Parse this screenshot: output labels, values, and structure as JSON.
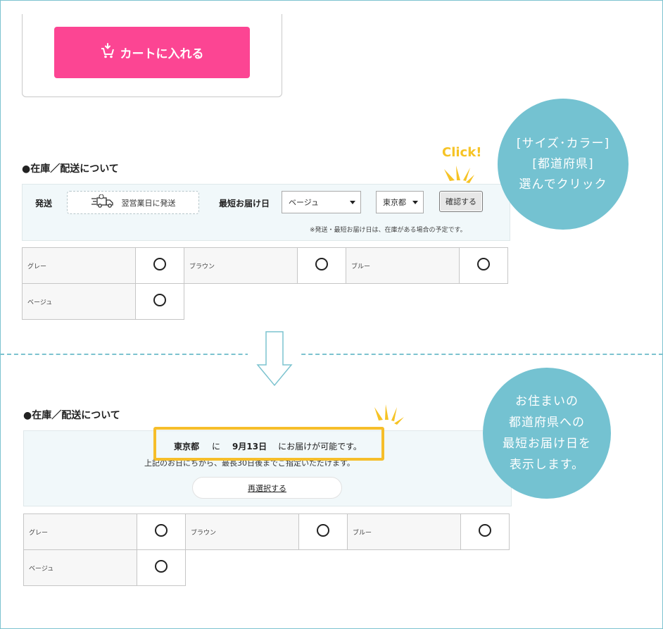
{
  "cart": {
    "button_label": "カートに入れる",
    "icon": "cart-icon"
  },
  "top": {
    "section_title": "●在庫／配送について",
    "shipping_label": "発送",
    "shipping_value": "翌営業日に発送",
    "shipping_icon": "truck-icon",
    "earliest_label": "最短お届け日",
    "color_select": "ベージュ",
    "region_select": "東京都",
    "confirm_label": "確認する",
    "note": "※発送・最短お届け日は、在庫がある場合の予定です。"
  },
  "click_callout": "Click!",
  "bubble1": {
    "line1": "[サイズ･カラー]",
    "line2": "[都道府県]",
    "line3": "選んでクリック"
  },
  "stock_top": [
    {
      "name": "グレー",
      "mark": "circle"
    },
    {
      "name": "ブラウン",
      "mark": "circle"
    },
    {
      "name": "ブルー",
      "mark": "circle"
    },
    {
      "name": "ベージュ",
      "mark": "circle"
    }
  ],
  "bottom": {
    "section_title": "●在庫／配送について",
    "region": "東京都",
    "particle": "に",
    "date": "9月13日",
    "date_suffix": "にお届けが可能です。",
    "subtext": "上記のお日にちから、最長30日後までご指定いただけます。",
    "reselect_label": "再選択する"
  },
  "bubble2": {
    "line1": "お住まいの",
    "line2": "都道府県への",
    "line3": "最短お届け日を",
    "line4": "表示します。"
  },
  "stock_bottom": [
    {
      "name": "グレー",
      "mark": "circle"
    },
    {
      "name": "ブラウン",
      "mark": "circle"
    },
    {
      "name": "ブルー",
      "mark": "circle"
    },
    {
      "name": "ベージュ",
      "mark": "circle"
    }
  ],
  "colors": {
    "accent_pink": "#fc4593",
    "teal": "#74c2d1",
    "highlight": "#f6be2a"
  }
}
